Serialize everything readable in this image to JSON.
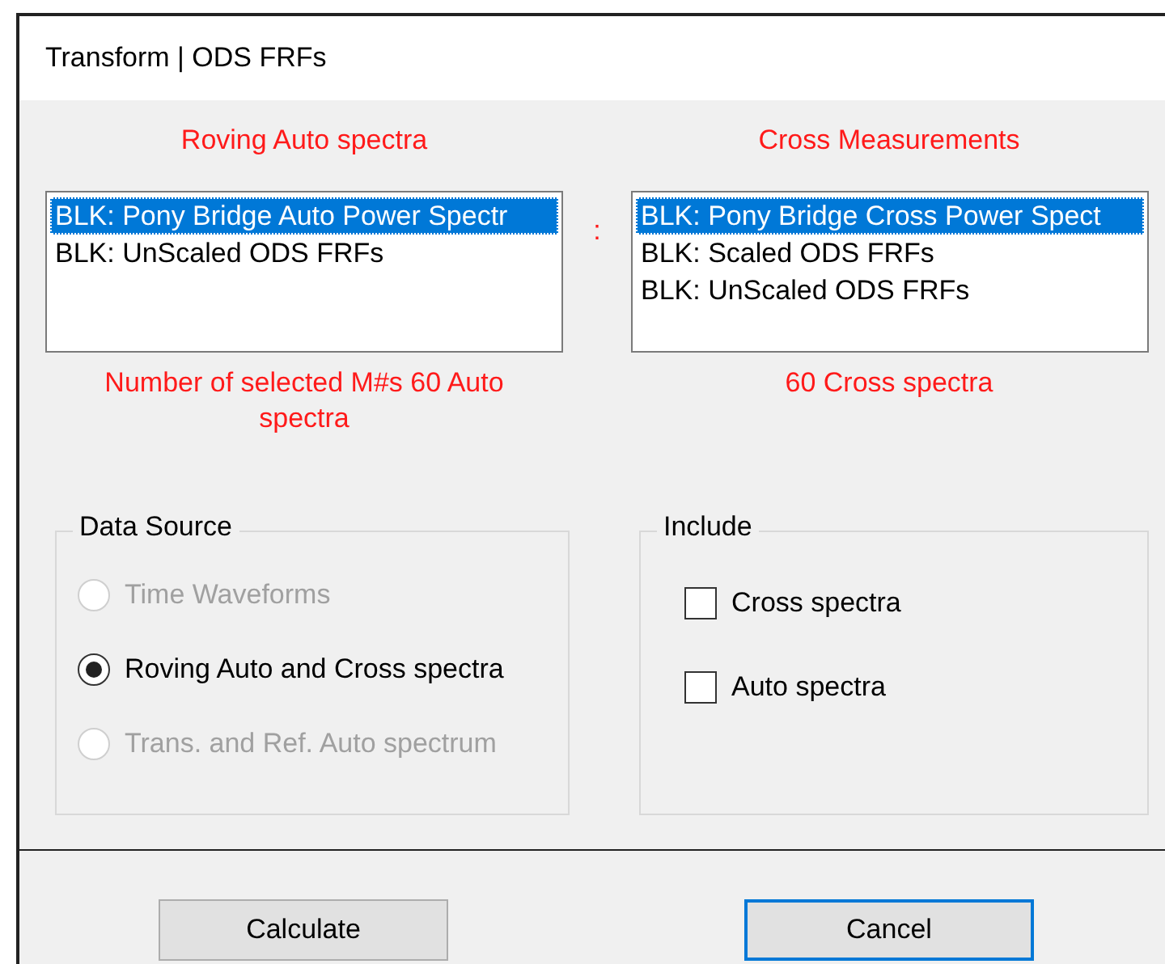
{
  "window": {
    "title": "Transform | ODS FRFs"
  },
  "auto_list": {
    "heading": "Roving Auto spectra",
    "items": [
      {
        "label": "BLK: Pony Bridge Auto Power Spectr",
        "selected": true
      },
      {
        "label": "BLK: UnScaled ODS FRFs",
        "selected": false
      }
    ],
    "count": "Number of selected M#s 60 Auto spectra"
  },
  "separator": ":",
  "cross_list": {
    "heading": "Cross Measurements",
    "items": [
      {
        "label": "BLK: Pony Bridge Cross Power Spect",
        "selected": true
      },
      {
        "label": "BLK: Scaled ODS FRFs",
        "selected": false
      },
      {
        "label": "BLK: UnScaled ODS FRFs",
        "selected": false
      }
    ],
    "count": "60 Cross spectra"
  },
  "data_source": {
    "title": "Data Source",
    "options": [
      {
        "label": "Time Waveforms",
        "selected": false,
        "disabled": true
      },
      {
        "label": "Roving Auto and Cross spectra",
        "selected": true,
        "disabled": false
      },
      {
        "label": "Trans. and Ref. Auto spectrum",
        "selected": false,
        "disabled": true
      }
    ]
  },
  "include": {
    "title": "Include",
    "options": [
      {
        "label": "Cross spectra",
        "checked": false
      },
      {
        "label": "Auto spectra",
        "checked": false
      }
    ]
  },
  "buttons": [
    {
      "label": "Calculate",
      "default": false
    },
    {
      "label": "Cancel",
      "default": true
    }
  ]
}
